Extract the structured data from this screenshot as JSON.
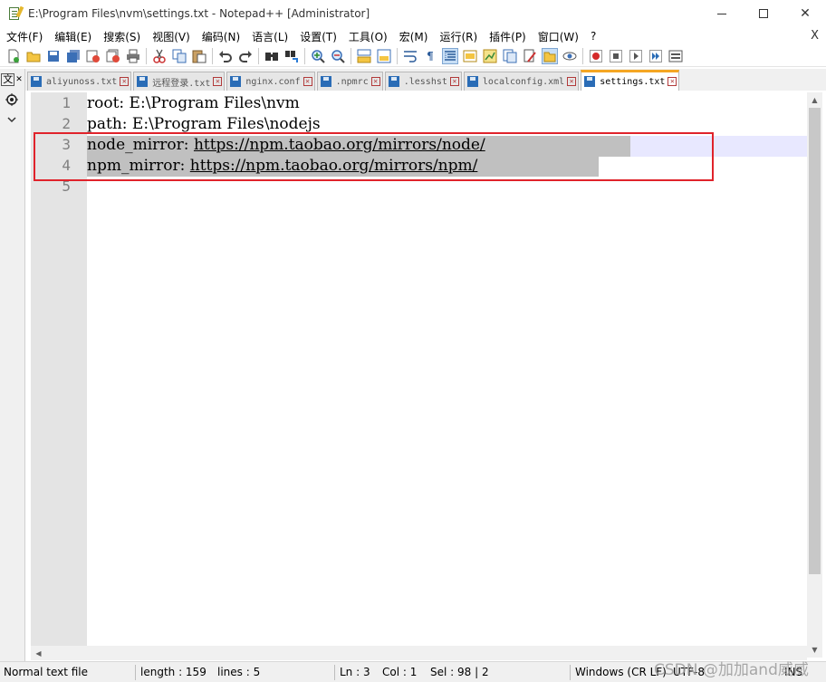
{
  "window": {
    "title": "E:\\Program Files\\nvm\\settings.txt - Notepad++ [Administrator]",
    "minimize": "—",
    "maximize": "□",
    "close": "✕"
  },
  "menu": {
    "items": [
      "文件(F)",
      "编辑(E)",
      "搜索(S)",
      "视图(V)",
      "编码(N)",
      "语言(L)",
      "设置(T)",
      "工具(O)",
      "宏(M)",
      "运行(R)",
      "插件(P)",
      "窗口(W)",
      "?"
    ],
    "close_doc": "X"
  },
  "toolbar": {
    "icons": [
      "new-file-icon",
      "open-file-icon",
      "save-icon",
      "save-all-icon",
      "close-icon",
      "close-all-icon",
      "print-icon",
      "cut-icon",
      "copy-icon",
      "paste-icon",
      "undo-icon",
      "redo-icon",
      "find-icon",
      "replace-icon",
      "zoom-in-icon",
      "zoom-out-icon",
      "sync-vertical-icon",
      "sync-horizontal-icon",
      "word-wrap-icon",
      "show-all-chars-icon",
      "indent-guide-icon",
      "udl-icon",
      "doc-map-icon",
      "function-list-icon",
      "folder-as-workspace-icon",
      "monitoring-icon",
      "record-macro-icon",
      "stop-record-icon",
      "playback-macro-icon",
      "run-macro-multiple-icon",
      "save-macro-icon"
    ]
  },
  "side_panel": {
    "label": "文"
  },
  "tabs": [
    {
      "label": "aliyunoss.txt",
      "active": false
    },
    {
      "label": "远程登录.txt",
      "active": false
    },
    {
      "label": "nginx.conf",
      "active": false
    },
    {
      "label": ".npmrc",
      "active": false
    },
    {
      "label": ".lesshst",
      "active": false
    },
    {
      "label": "localconfig.xml",
      "active": false
    },
    {
      "label": "settings.txt",
      "active": true
    }
  ],
  "editor": {
    "lines": [
      {
        "no": "1",
        "prefix": "root: E:\\Program Files\\nvm",
        "url": ""
      },
      {
        "no": "2",
        "prefix": "path: E:\\Program Files\\nodejs",
        "url": ""
      },
      {
        "no": "3",
        "prefix": "node_mirror: ",
        "url": "https://npm.taobao.org/mirrors/node/"
      },
      {
        "no": "4",
        "prefix": "npm_mirror: ",
        "url": "https://npm.taobao.org/mirrors/npm/"
      },
      {
        "no": "5",
        "prefix": "",
        "url": ""
      }
    ]
  },
  "status": {
    "file_type": "Normal text file",
    "length": "length : 159",
    "lines": "lines : 5",
    "ln": "Ln : 3",
    "col": "Col : 1",
    "sel": "Sel : 98 | 2",
    "eol": "Windows (CR LF)",
    "encoding": "UTF-8",
    "mode": "INS"
  },
  "watermark": "CSDN @加加and威威",
  "colors": {
    "highlight_box": "#e0232b",
    "active_tab_accent": "#f5a623",
    "selection": "#c0c0c0",
    "current_line": "#e8e8ff"
  }
}
